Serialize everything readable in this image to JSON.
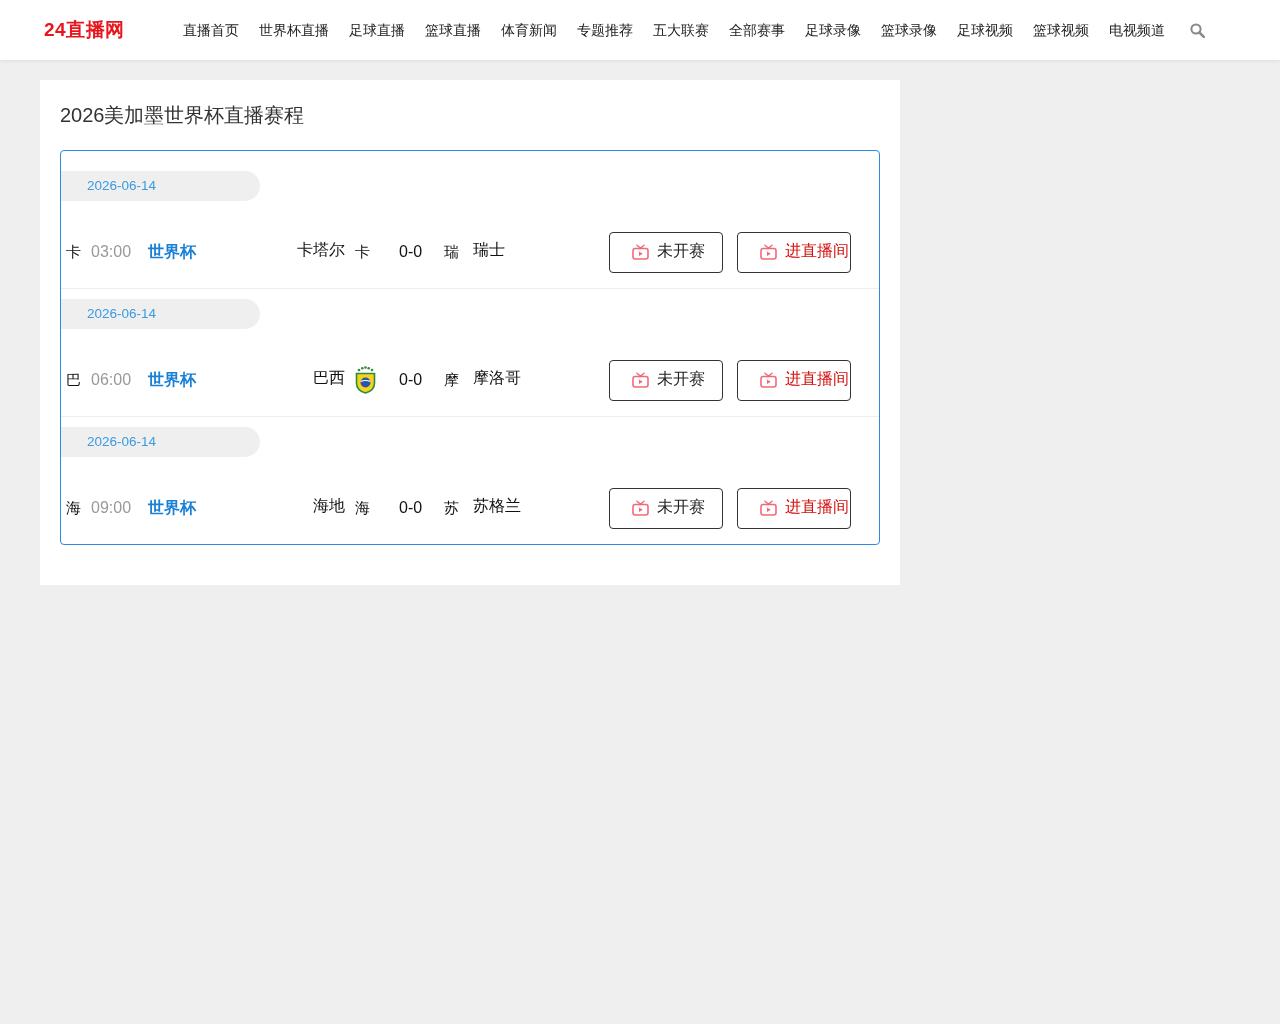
{
  "header": {
    "logo": "24直播网",
    "nav": [
      {
        "label": "直播首页"
      },
      {
        "label": "世界杯直播"
      },
      {
        "label": "足球直播"
      },
      {
        "label": "篮球直播"
      },
      {
        "label": "体育新闻"
      },
      {
        "label": "专题推荐"
      },
      {
        "label": "五大联赛"
      },
      {
        "label": "全部赛事"
      },
      {
        "label": "足球录像"
      },
      {
        "label": "篮球录像"
      },
      {
        "label": "足球视频"
      },
      {
        "label": "篮球视频"
      },
      {
        "label": "电视频道"
      }
    ]
  },
  "schedule": {
    "title": "2026美加墨世界杯直播赛程",
    "matches": [
      {
        "date": "2026-06-14",
        "image_alt": "卡",
        "time": "03:00",
        "league": "世界杯",
        "home": {
          "name": "卡塔尔",
          "logo": {
            "kind": "alt",
            "text": "卡"
          }
        },
        "score": "0-0",
        "away": {
          "name": "瑞士",
          "logo": {
            "kind": "alt",
            "text": "瑞"
          }
        },
        "buttons": [
          {
            "kind": "status",
            "label": "未开赛"
          },
          {
            "kind": "live",
            "label": "进直播间"
          }
        ]
      },
      {
        "date": "2026-06-14",
        "image_alt": "巴",
        "time": "06:00",
        "league": "世界杯",
        "home": {
          "name": "巴西",
          "logo": {
            "kind": "crest"
          }
        },
        "score": "0-0",
        "away": {
          "name": "摩洛哥",
          "logo": {
            "kind": "alt",
            "text": "摩"
          }
        },
        "buttons": [
          {
            "kind": "status",
            "label": "未开赛"
          },
          {
            "kind": "live",
            "label": "进直播间"
          }
        ]
      },
      {
        "date": "2026-06-14",
        "image_alt": "海",
        "time": "09:00",
        "league": "世界杯",
        "home": {
          "name": "海地",
          "logo": {
            "kind": "alt",
            "text": "海"
          }
        },
        "score": "0-0",
        "away": {
          "name": "苏格兰",
          "logo": {
            "kind": "alt",
            "text": "苏"
          }
        },
        "buttons": [
          {
            "kind": "status",
            "label": "未开赛"
          },
          {
            "kind": "live",
            "label": "进直播间"
          }
        ]
      }
    ]
  }
}
